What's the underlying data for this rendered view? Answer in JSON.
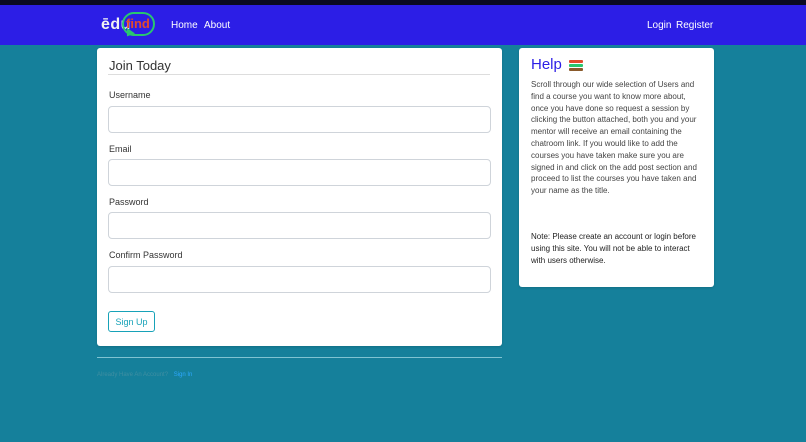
{
  "nav": {
    "logo_edu": "ēdu",
    "logo_find": "find",
    "home": "Home",
    "about": "About",
    "login": "Login",
    "register": "Register"
  },
  "form": {
    "title": "Join Today",
    "username_label": "Username",
    "email_label": "Email",
    "password_label": "Password",
    "confirm_label": "Confirm Password",
    "username_value": "",
    "email_value": "",
    "password_value": "",
    "confirm_value": "",
    "submit": "Sign Up"
  },
  "help": {
    "title": "Help",
    "icon": "books-icon",
    "body": "Scroll through our wide selection of Users and find a course you want to know more about, once you have done so request a session by clicking the button attached, both you and your mentor will receive an email containing the chatroom link. If you would like to add the courses you have taken make sure you are signed in and click on the add post section and proceed to list the courses you have taken and your name as the title.",
    "note": "Note: Please create an account or login before using this site. You will not be able to interact with users otherwise."
  },
  "footer": {
    "prompt": "Already Have An Account?",
    "link": "Sign In"
  },
  "colors": {
    "navbar": "#2c1ee6",
    "background": "#15809b",
    "accent": "#17a2b8"
  }
}
